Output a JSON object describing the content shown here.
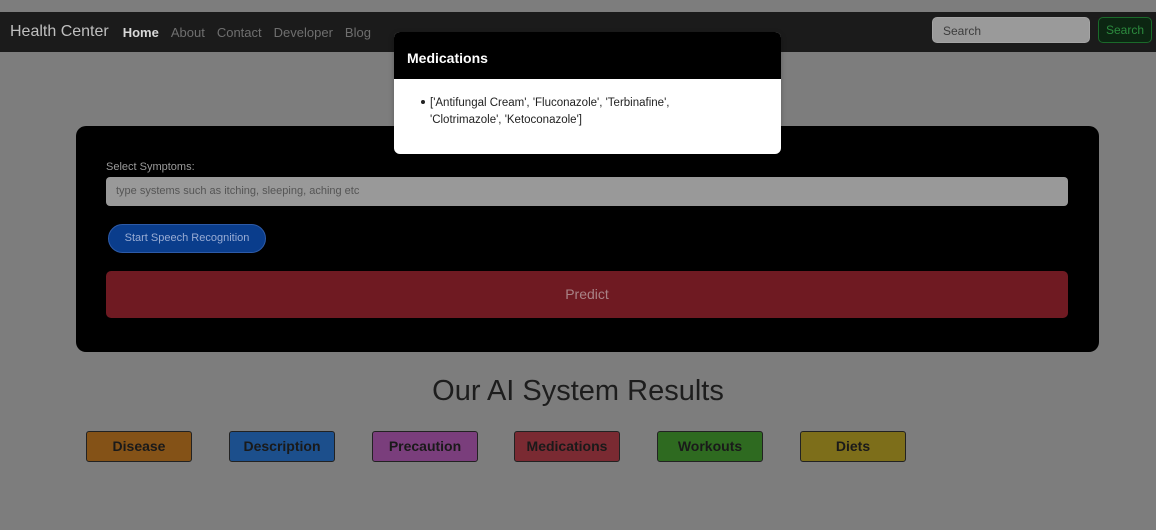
{
  "navbar": {
    "brand": "Health Center",
    "links": [
      "Home",
      "About",
      "Contact",
      "Developer",
      "Blog"
    ],
    "search_placeholder": "Search",
    "search_button": "Search"
  },
  "form": {
    "symptom_label": "Select Symptoms:",
    "symptom_placeholder": "type systems such as itching, sleeping, aching etc",
    "speech_button": "Start Speech Recognition",
    "predict_button": "Predict"
  },
  "results": {
    "heading": "Our AI System Results",
    "buttons": [
      {
        "label": "Disease",
        "color": "#845217"
      },
      {
        "label": "Description",
        "color": "#1c4f8c"
      },
      {
        "label": "Precaution",
        "color": "#7a3e7c"
      },
      {
        "label": "Medications",
        "color": "#7a2a32"
      },
      {
        "label": "Workouts",
        "color": "#2e6a20"
      },
      {
        "label": "Diets",
        "color": "#7d6e1a"
      }
    ]
  },
  "modal": {
    "title": "Medications",
    "items": [
      "['Antifungal Cream', 'Fluconazole', 'Terbinafine', 'Clotrimazole', 'Ketoconazole']"
    ]
  }
}
